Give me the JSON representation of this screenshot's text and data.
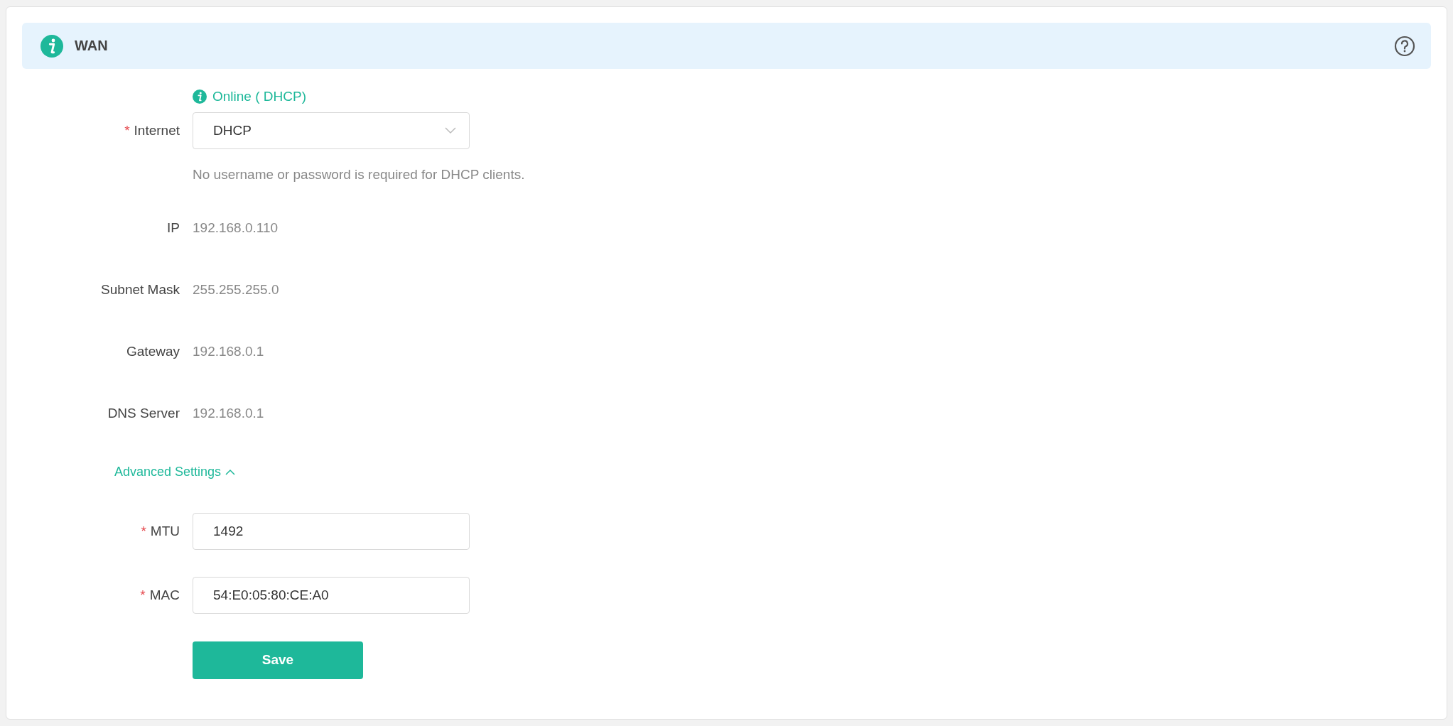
{
  "section": {
    "title": "WAN"
  },
  "status": {
    "text": "Online ( DHCP)"
  },
  "internet": {
    "required_mark": "*",
    "label": "Internet",
    "value": "DHCP",
    "hint": "No username or password is required for DHCP clients."
  },
  "info_rows": [
    {
      "label": "IP",
      "value": "192.168.0.110"
    },
    {
      "label": "Subnet Mask",
      "value": "255.255.255.0"
    },
    {
      "label": "Gateway",
      "value": "192.168.0.1"
    },
    {
      "label": "DNS Server",
      "value": "192.168.0.1"
    }
  ],
  "advanced": {
    "label": "Advanced Settings",
    "expanded": true
  },
  "advanced_fields": [
    {
      "required_mark": "*",
      "label": "MTU",
      "value": "1492"
    },
    {
      "required_mark": "*",
      "label": "MAC",
      "value": "54:E0:05:80:CE:A0"
    }
  ],
  "save_button": "Save"
}
